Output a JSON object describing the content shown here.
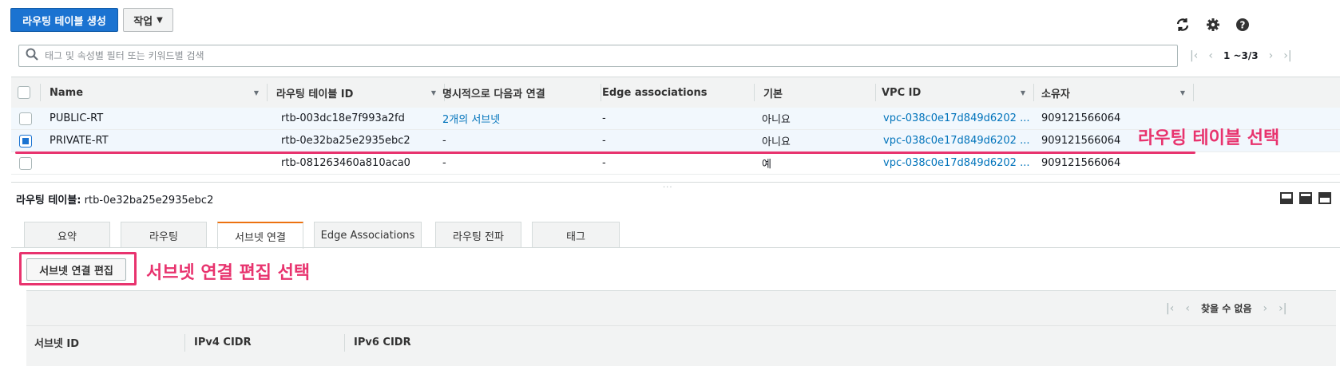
{
  "toolbar": {
    "create_label": "라우팅 테이블 생성",
    "actions_label": "작업",
    "actions_caret": "⌄",
    "refresh_icon": "refresh-icon",
    "settings_icon": "gear-icon",
    "help_icon": "help-icon"
  },
  "search": {
    "placeholder": "태그 및 속성별 필터 또는 키워드별 검색"
  },
  "pager": {
    "count": "1 ~3/3"
  },
  "table": {
    "columns": [
      "Name",
      "라우팅 테이블 ID",
      "명시적으로 다음과 연결",
      "Edge associations",
      "기본",
      "VPC ID",
      "소유자"
    ],
    "rows": [
      {
        "name": "PUBLIC-RT",
        "id": "rtb-003dc18e7f993a2fd",
        "explicit": "2개의 서브넷",
        "edge": "-",
        "main": "아니요",
        "vpc": "vpc-038c0e17d849d6202 ...",
        "owner": "909121566064",
        "selected": false
      },
      {
        "name": "PRIVATE-RT",
        "id": "rtb-0e32ba25e2935ebc2",
        "explicit": "-",
        "edge": "-",
        "main": "아니요",
        "vpc": "vpc-038c0e17d849d6202 ...",
        "owner": "909121566064",
        "selected": true
      },
      {
        "name": "",
        "id": "rtb-081263460a810aca0",
        "explicit": "-",
        "edge": "-",
        "main": "예",
        "vpc": "vpc-038c0e17d849d6202 ...",
        "owner": "909121566064",
        "selected": false
      }
    ]
  },
  "annotations": {
    "row_select": "라우팅 테이블 선택",
    "edit_select": "서브넷 연결 편집 선택"
  },
  "annotation_color": "#e8336e",
  "detail": {
    "title_label": "라우팅 테이블:",
    "title_value": "rtb-0e32ba25e2935ebc2",
    "tabs": [
      "요약",
      "라우팅",
      "서브넷 연결",
      "Edge Associations",
      "라우팅 전파",
      "태그"
    ],
    "active_tab": "서브넷 연결",
    "edit_button": "서브넷 연결 편집",
    "sub_pager": "찾을 수 없음",
    "sub_columns": [
      "서브넷 ID",
      "IPv4 CIDR",
      "IPv6 CIDR"
    ]
  },
  "colors": {
    "primary": "#1b73d1",
    "link": "#0073bb",
    "active_tab_accent": "#ec7211"
  }
}
